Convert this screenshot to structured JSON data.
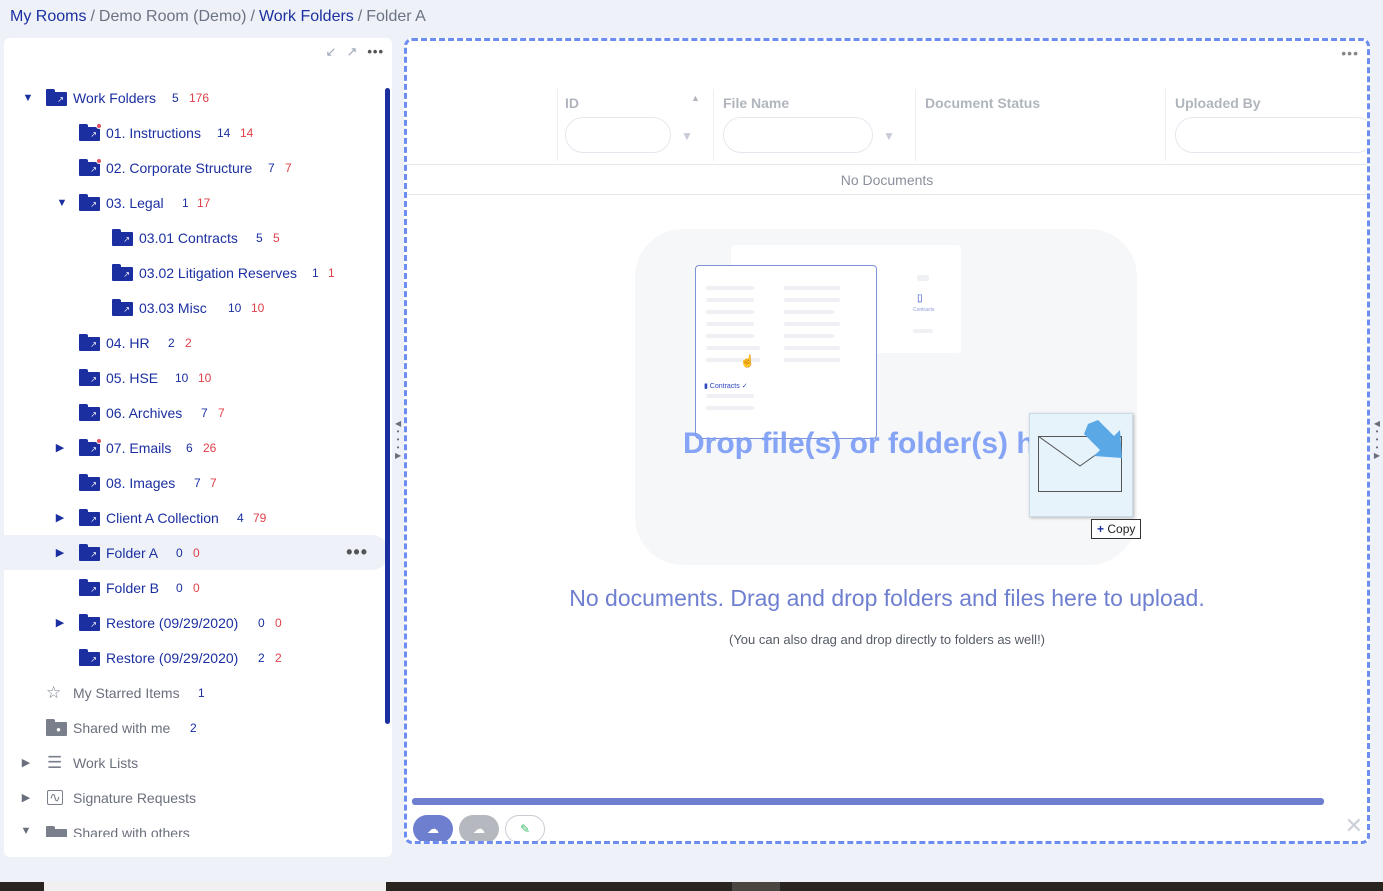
{
  "breadcrumb": [
    {
      "label": "My Rooms",
      "link": true
    },
    {
      "label": "Demo Room (Demo)",
      "link": false
    },
    {
      "label": "Work Folders",
      "link": true
    },
    {
      "label": "Folder A",
      "link": false
    }
  ],
  "tree": {
    "root": {
      "label": "Work Folders",
      "c1": "5",
      "c2": "176"
    },
    "items": [
      {
        "label": "01. Instructions",
        "c1": "14",
        "c2": "14"
      },
      {
        "label": "02. Corporate Structure",
        "c1": "7",
        "c2": "7"
      },
      {
        "label": "03. Legal",
        "c1": "1",
        "c2": "17"
      },
      {
        "label": "03.01 Contracts",
        "c1": "5",
        "c2": "5"
      },
      {
        "label": "03.02 Litigation Reserves",
        "c1": "1",
        "c2": "1"
      },
      {
        "label": "03.03 Misc",
        "c1": "10",
        "c2": "10"
      },
      {
        "label": "04. HR",
        "c1": "2",
        "c2": "2"
      },
      {
        "label": "05. HSE",
        "c1": "10",
        "c2": "10"
      },
      {
        "label": "06. Archives",
        "c1": "7",
        "c2": "7"
      },
      {
        "label": "07. Emails",
        "c1": "6",
        "c2": "26"
      },
      {
        "label": "08. Images",
        "c1": "7",
        "c2": "7"
      },
      {
        "label": "Client A Collection",
        "c1": "4",
        "c2": "79"
      },
      {
        "label": "Folder A",
        "c1": "0",
        "c2": "0"
      },
      {
        "label": "Folder B",
        "c1": "0",
        "c2": "0"
      },
      {
        "label": "Restore (09/29/2020)",
        "c1": "0",
        "c2": "0"
      },
      {
        "label": "Restore (09/29/2020)",
        "c1": "2",
        "c2": "2"
      }
    ],
    "starred": {
      "label": "My Starred Items",
      "c1": "1"
    },
    "shared_with_me": {
      "label": "Shared with me",
      "c1": "2"
    },
    "work_lists": {
      "label": "Work Lists"
    },
    "signature_requests": {
      "label": "Signature Requests"
    },
    "shared_with_others": {
      "label": "Shared with others"
    }
  },
  "table": {
    "columns": [
      "ID",
      "File Name",
      "Document Status",
      "Uploaded By"
    ],
    "empty_text": "No Documents"
  },
  "dropzone": {
    "title": "Drop file(s) or folder(s) here.",
    "illus_folder_label": "Contracts",
    "illus_folder_label_small": "Contracts",
    "copy_label": "Copy",
    "message": "No documents. Drag and drop folders and files here to upload.",
    "submessage": "(You can also drag and drop directly to folders as well!)"
  },
  "colors": {
    "brand": "#1b2fa0",
    "accent": "#6e7fd0",
    "count_red": "#e0404a",
    "dropzone_border": "#6d8ef0"
  }
}
